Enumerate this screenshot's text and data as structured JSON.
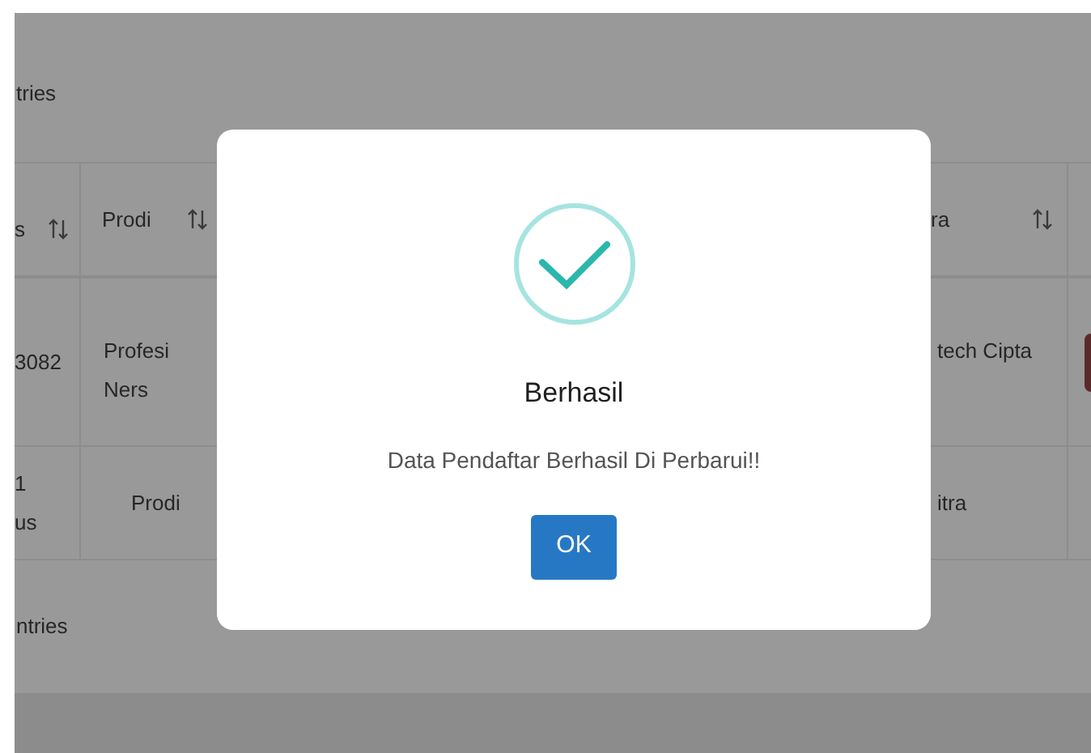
{
  "page": {
    "entries_top": "tries",
    "entries_bottom": "ntries",
    "columns": [
      {
        "label": "s"
      },
      {
        "label": "Prodi"
      },
      {
        "label": "ra"
      }
    ],
    "rows": [
      {
        "cells": [
          "3082",
          "Profesi Ners",
          "tech Cipta"
        ]
      },
      {
        "cells": [
          "1 us",
          "Prodi",
          "itra"
        ]
      }
    ]
  },
  "dialog": {
    "title": "Berhasil",
    "message": "Data Pendaftar Berhasil Di Perbarui!!",
    "button": "OK"
  }
}
